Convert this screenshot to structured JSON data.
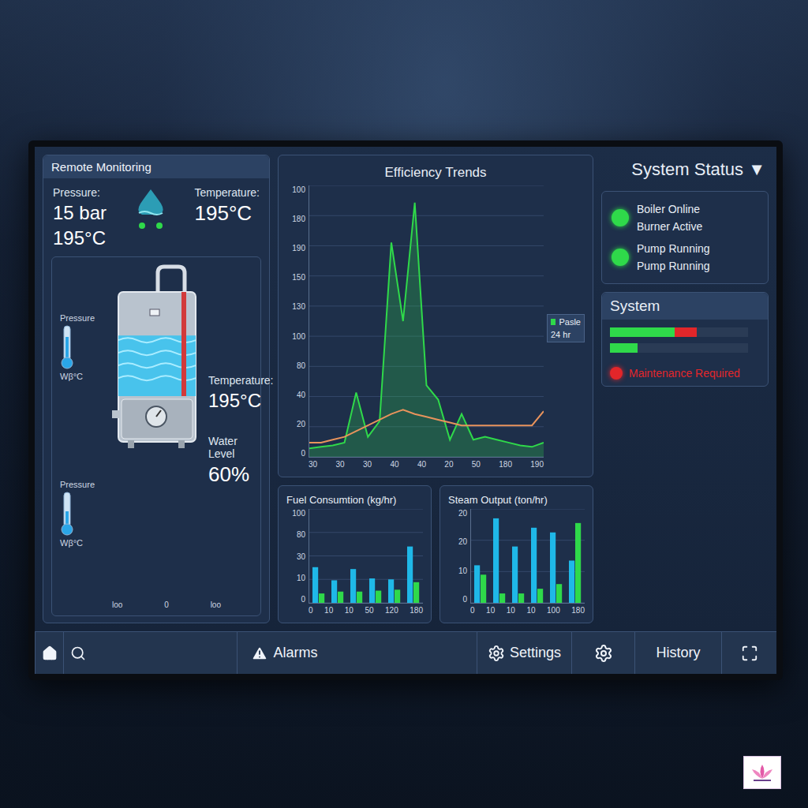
{
  "status_header": {
    "title": "System Status",
    "caret": "▼"
  },
  "monitoring": {
    "title": "Remote Monitoring",
    "pressure_label": "Pressure:",
    "pressure": "15 bar",
    "pressure_temp": "195°C",
    "temp_label": "Temperature:",
    "temp": "195°C"
  },
  "boiler": {
    "gauges": [
      {
        "label": "Pressure",
        "reading": "Wβ°C",
        "level": 0.7
      },
      {
        "label": "Pressure",
        "reading": "Wβ°C",
        "level": 0.45
      }
    ],
    "temp_label": "Temperature:",
    "temp": "195°C",
    "water_label": "Water Level",
    "water_text": "60%",
    "level": 0.6,
    "axis": [
      "loo",
      "0",
      "loo"
    ]
  },
  "efficiency": {
    "title": "Efficiency Trends",
    "y_ticks": [
      "100",
      "180",
      "190",
      "150",
      "130",
      "100",
      "80",
      "40",
      "20",
      "0"
    ],
    "x_ticks": [
      "30",
      "30",
      "30",
      "40",
      "40",
      "20",
      "50",
      "180",
      "190"
    ],
    "legend": {
      "label": "Pasle",
      "period": "24 hr",
      "color": "#2fd94a"
    },
    "series": [
      {
        "color": "#2fd94a",
        "values": [
          6,
          7,
          8,
          10,
          45,
          14,
          25,
          150,
          95,
          178,
          50,
          40,
          12,
          30,
          12,
          14,
          12,
          10,
          8,
          7,
          10
        ]
      },
      {
        "color": "#e8935c",
        "values": [
          10,
          10,
          12,
          14,
          18,
          22,
          26,
          30,
          33,
          30,
          28,
          26,
          24,
          22,
          22,
          22,
          22,
          22,
          22,
          22,
          32
        ]
      }
    ]
  },
  "fuel": {
    "title": "Fuel Consumtion (kg/hr)",
    "y_ticks": [
      "100",
      "80",
      "30",
      "10",
      "0"
    ],
    "x_ticks": [
      "0",
      "10",
      "10",
      "50",
      "120",
      "180"
    ],
    "series": [
      {
        "color": "#1fb8e8",
        "values": [
          38,
          24,
          36,
          26,
          25,
          60
        ]
      },
      {
        "color": "#2fd94a",
        "values": [
          10,
          12,
          12,
          13,
          14,
          22
        ]
      }
    ]
  },
  "steam": {
    "title": "Steam Output (ton/hr)",
    "y_ticks": [
      "20",
      "20",
      "10",
      "0"
    ],
    "x_ticks": [
      "0",
      "10",
      "10",
      "10",
      "100",
      "180"
    ],
    "series": [
      {
        "color": "#1fb8e8",
        "values": [
          8,
          18,
          12,
          16,
          15,
          9
        ]
      },
      {
        "color": "#2fd94a",
        "values": [
          6,
          2,
          2,
          3,
          4,
          17
        ]
      }
    ]
  },
  "status": {
    "items": [
      {
        "lines": [
          "Boiler Online",
          "Burner Active"
        ],
        "color": "#2fd94a"
      },
      {
        "lines": [
          "Pump Running",
          "Pump Running"
        ],
        "color": "#2fd94a"
      }
    ]
  },
  "system": {
    "title": "System",
    "bars": [
      {
        "segments": [
          {
            "level": 0.47,
            "color": "#2fd94a"
          },
          {
            "level": 0.16,
            "color": "#e2262a"
          }
        ]
      },
      {
        "segments": [
          {
            "level": 0.2,
            "color": "#2fd94a"
          }
        ]
      }
    ],
    "alert": {
      "text": "Maintenance Required",
      "color": "#e2262a"
    }
  },
  "nav": [
    {
      "kind": "home",
      "label": ""
    },
    {
      "kind": "search",
      "label": ""
    },
    {
      "kind": "alarms",
      "label": "Alarms"
    },
    {
      "kind": "settings",
      "label": "Settings"
    },
    {
      "kind": "gear",
      "label": ""
    },
    {
      "kind": "history",
      "label": "History"
    },
    {
      "kind": "fullscreen",
      "label": ""
    }
  ]
}
